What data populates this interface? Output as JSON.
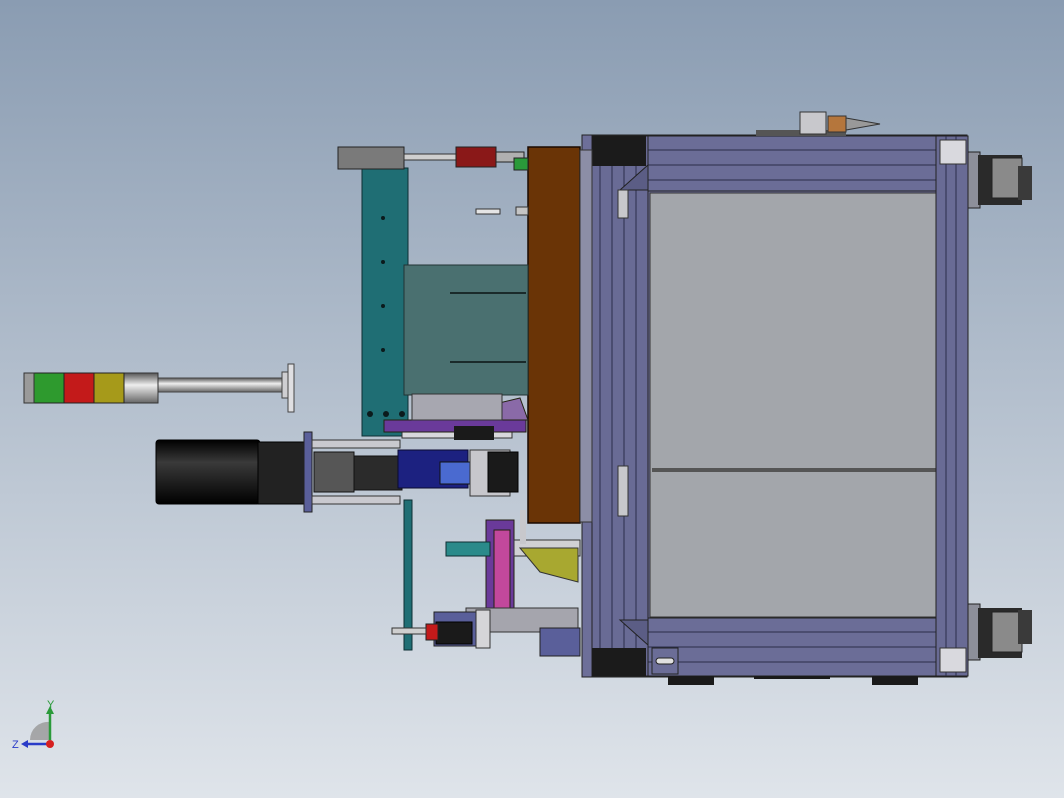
{
  "viewport": {
    "background_top": "#8a9cb2",
    "background_bottom": "#dfe4ea"
  },
  "triad": {
    "y_label": "Y",
    "z_label": "Z",
    "y_color": "#2a9a3a",
    "z_color": "#2a3cc8",
    "x_color": "#d62020"
  },
  "colors": {
    "frame": "#6d6f99",
    "frame_dark": "#3f4266",
    "panel": "#a3a6ab",
    "brown_plate": "#6a3406",
    "teal_plate": "#1f6e74",
    "motor_black": "#1a1a1a",
    "light_red": "#c31a1a",
    "light_green": "#2e9a2e",
    "light_yellow": "#a69a1a",
    "purple": "#6a3a9a",
    "yellow_part": "#a8a830"
  }
}
